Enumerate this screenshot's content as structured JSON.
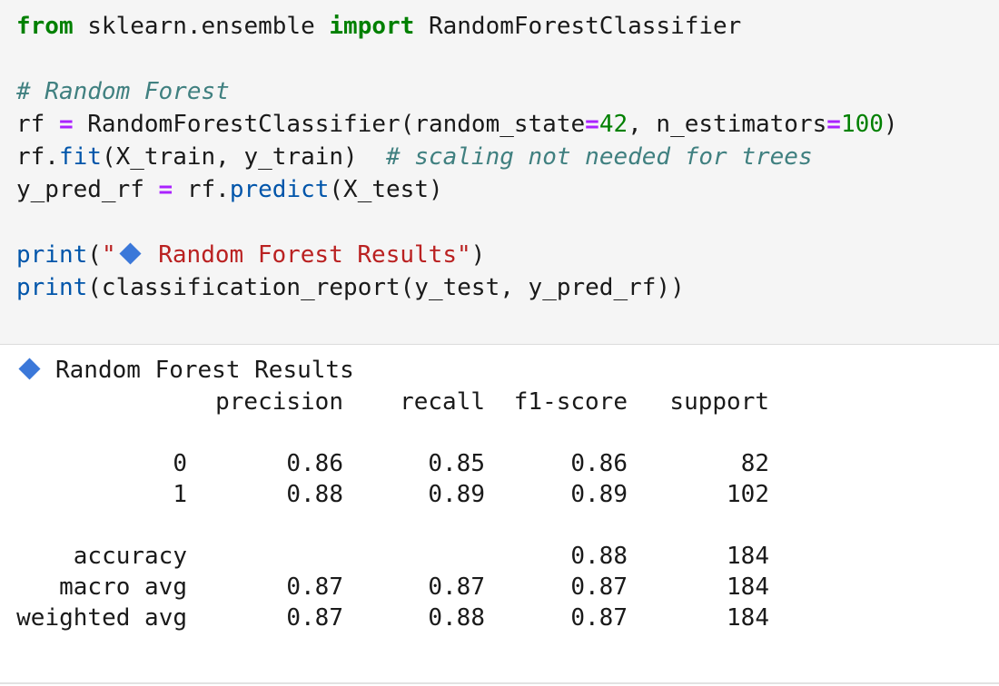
{
  "code": {
    "line1": {
      "kw_from": "from",
      "module": " sklearn.ensemble ",
      "kw_import": "import",
      "cls": " RandomForestClassifier"
    },
    "line2": {
      "comment": "# Random Forest"
    },
    "line3": {
      "a": "rf ",
      "eq": "=",
      "b": " RandomForestClassifier(random_state",
      "eq2": "=",
      "n1": "42",
      "c": ", n_estimators",
      "eq3": "=",
      "n2": "100",
      "d": ")"
    },
    "line4": {
      "a": "rf.",
      "fn": "fit",
      "b": "(X_train, y_train)  ",
      "comment": "# scaling not needed for trees"
    },
    "line5": {
      "a": "y_pred_rf ",
      "eq": "=",
      "b": " rf.",
      "fn": "predict",
      "c": "(X_test)"
    },
    "line6": {
      "fn": "print",
      "p1": "(",
      "q1": "\"",
      "str": " Random Forest Results\"",
      "p2": ")"
    },
    "line7": {
      "fn": "print",
      "rest": "(classification_report(y_test, y_pred_rf))"
    }
  },
  "output": {
    "title": "Random Forest Results",
    "columns": [
      "precision",
      "recall",
      "f1-score",
      "support"
    ],
    "rows": [
      {
        "label": "0",
        "precision": "0.86",
        "recall": "0.85",
        "f1": "0.86",
        "support": "82"
      },
      {
        "label": "1",
        "precision": "0.88",
        "recall": "0.89",
        "f1": "0.89",
        "support": "102"
      },
      {
        "label": "accuracy",
        "precision": "",
        "recall": "",
        "f1": "0.88",
        "support": "184"
      },
      {
        "label": "macro avg",
        "precision": "0.87",
        "recall": "0.87",
        "f1": "0.87",
        "support": "184"
      },
      {
        "label": "weighted avg",
        "precision": "0.87",
        "recall": "0.88",
        "f1": "0.87",
        "support": "184"
      }
    ]
  },
  "colors": {
    "diamond": "#3b78d9",
    "keyword": "#008000",
    "comment": "#408080",
    "string": "#ba2121",
    "operator": "#aa22ff",
    "function": "#0055aa"
  },
  "icons": {
    "diamond": "blue-diamond-icon"
  }
}
